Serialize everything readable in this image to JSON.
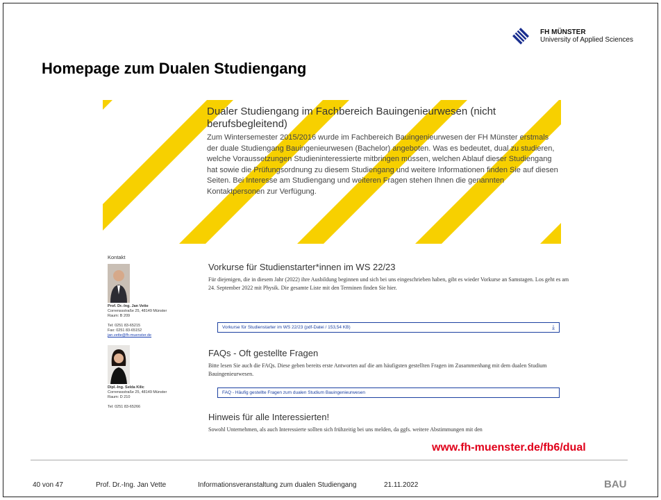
{
  "logo": {
    "line1": "FH MÜNSTER",
    "line2": "University of Applied Sciences"
  },
  "title": "Homepage zum Dualen Studiengang",
  "hero": {
    "heading": "Dualer Studiengang im Fachbereich Bauingenieurwesen (nicht berufsbegleitend)",
    "paragraph": "Zum Wintersemester 2015/2016 wurde im Fachbereich Bauingenieurwesen der FH Münster erstmals der duale Studiengang Bauingenieurwesen (Bachelor) angeboten. Was es bedeutet, dual zu studieren, welche Voraussetzungen Studieninteressierte mitbringen müssen, welchen Ablauf dieser Studiengang hat sowie die Prüfungsordnung zu diesem Studiengang und weitere Informationen finden Sie auf diesen Seiten. Bei Interesse am Studiengang und weiteren Fragen stehen Ihnen die genannten Kontaktpersonen zur Verfügung."
  },
  "contact": {
    "heading": "Kontakt",
    "person1": {
      "name": "Prof. Dr.-Ing. Jan Vette",
      "address": "Correnssstraße 25, 48149 Münster",
      "room": "Raum: B 209",
      "tel": "Tel: 0251 83-65215",
      "fax": "Fax: 0251 83-65152",
      "email": "jan.vette@fh-muenster.de"
    },
    "person2": {
      "name": "Dipl.-Ing. Selda Kilic",
      "address": "Correnssstraße 25, 48149 Münster",
      "room": "Raum: D 210",
      "tel": "Tel: 0251 83-65266"
    }
  },
  "section1": {
    "heading": "Vorkurse für Studienstarter*innen im WS 22/23",
    "text": "Für diejenigen, die in diesem Jahr (2022) ihre Ausbildung beginnen und sich bei uns eingeschrieben haben, gibt es wieder Vorkurse an Samstagen. Los geht es am 24. September 2022 mit Physik. Die gesamte Liste mit den Terminen finden Sie hier.",
    "download": "Vorkurse für Studienstarter im WS 22/23 (pdf-Datei / 153,54 KB)",
    "download_icon": "download-arrow-icon"
  },
  "section2": {
    "heading": "FAQs - Oft gestellte Fragen",
    "text": "Bitte lesen Sie auch die FAQs. Diese geben bereits erste Antworten auf die am häufigsten gestellten Fragen im Zusammenhang mit dem dualen Studium Bauingenieurwesen.",
    "link": "FAQ - Häufig gestellte Fragen zum dualen Studium Bauingenieurwesen"
  },
  "section3": {
    "heading": "Hinweis für alle Interessierten!",
    "text": "Sowohl Unternehmen, als auch Interessierte sollten sich frühzeitig bei uns melden, da ggfs. weitere Abstimmungen mit den"
  },
  "url": "www.fh-muenster.de/fb6/dual",
  "footer": {
    "page": "40 von 47",
    "author": "Prof. Dr.-Ing. Jan Vette",
    "event": "Informationsveranstaltung zum dualen Studiengang",
    "date": "21.11.2022",
    "dept": "BAU"
  },
  "colors": {
    "stripe": "#f7d000",
    "accent_red": "#e0001a",
    "link_blue": "#1a3fa0"
  }
}
